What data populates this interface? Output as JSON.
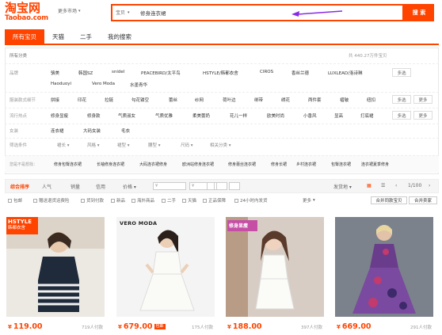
{
  "header": {
    "logo_main": "淘宝网",
    "logo_sub": "Taobao.com",
    "market_label": "更多市场",
    "search_scope": "宝贝",
    "search_query": "修身连衣裙",
    "search_button": "搜 索"
  },
  "tabs": [
    "所有宝贝",
    "天猫",
    "二手",
    "我的搜索"
  ],
  "filters": {
    "all_categories": "所有分类",
    "count_text": "共 440.27万件宝贝",
    "brand_label": "品牌",
    "brand_row1": [
      "骆美",
      "韩国SZ",
      "snidel",
      "PEACEBIRD/太平鸟",
      "HSTYLE/韩都衣舍",
      "CIROS",
      "香丝兰德",
      "LUXLEAD/洛诗琳"
    ],
    "brand_row2": [
      "Haoduoyi",
      "Vero Moda",
      "水墨青华"
    ],
    "multi": "多选",
    "more": "更多",
    "pattern_label": "服装款式细节",
    "pattern_items": [
      "拼接",
      "印花",
      "拉链",
      "勾花镂空",
      "蕾丝",
      "纱网",
      "荷叶边",
      "绑带",
      "绣花",
      "两件套",
      "褶皱",
      "纽扣"
    ],
    "style_label": "流行热点",
    "style_items": [
      "修身显瘦",
      "修身款",
      "气质淑女",
      "气质优雅",
      "柔美蕾奶",
      "花儿一样",
      "欧美时尚",
      "小香风",
      "显高",
      "打底裙"
    ],
    "category_label": "女装",
    "category_items": [
      "连衣裙",
      "大码女装",
      "毛衣"
    ],
    "sift_label": "筛选条件",
    "sift_items": [
      "裙长",
      "风格",
      "裙型",
      "腰型",
      "尺码",
      "相关分类"
    ],
    "guess_label": "您是不是想找：",
    "guess_items": [
      "修身包臀连衣裙",
      "长袖修身连衣裙",
      "大码连衣裙修身",
      "欧洲站修身连衣裙",
      "修身蕾丝连衣裙",
      "修身长裙",
      "乡村连衣裙",
      "包臀连衣裙",
      "连衣裙夏季修身"
    ]
  },
  "sortbar": {
    "items": [
      "综合排序",
      "人气",
      "销量",
      "信用",
      "价格"
    ],
    "price_from": "¥",
    "price_to": "¥",
    "ship_from": "发货地",
    "page": "1/100"
  },
  "options": {
    "items": [
      "包邮",
      "赠送退货运费险",
      "货到付款",
      "新品",
      "海外商品",
      "二手",
      "天猫",
      "正品保障",
      "24小时内发货"
    ],
    "more": "更多",
    "btn1": "合并同款宝贝",
    "btn2": "合并卖家"
  },
  "products": [
    {
      "price": "119.00",
      "paid": "719人付款",
      "brand_text": "HSTYLE",
      "brand_sub": "韩都衣舍",
      "img_bg": "#e8e4df"
    },
    {
      "price": "679.00",
      "paid": "175人付款",
      "brand_text": "VERO MODA",
      "badge": "包邮",
      "img_bg": "#f5f5f5"
    },
    {
      "price": "188.00",
      "paid": "397人付款",
      "brand_text": "修身显瘦",
      "img_bg": "#d9cfc7"
    },
    {
      "price": "669.00",
      "paid": "291人付款",
      "img_bg": "#8a8f96"
    }
  ],
  "colors": {
    "accent": "#ff4400"
  }
}
